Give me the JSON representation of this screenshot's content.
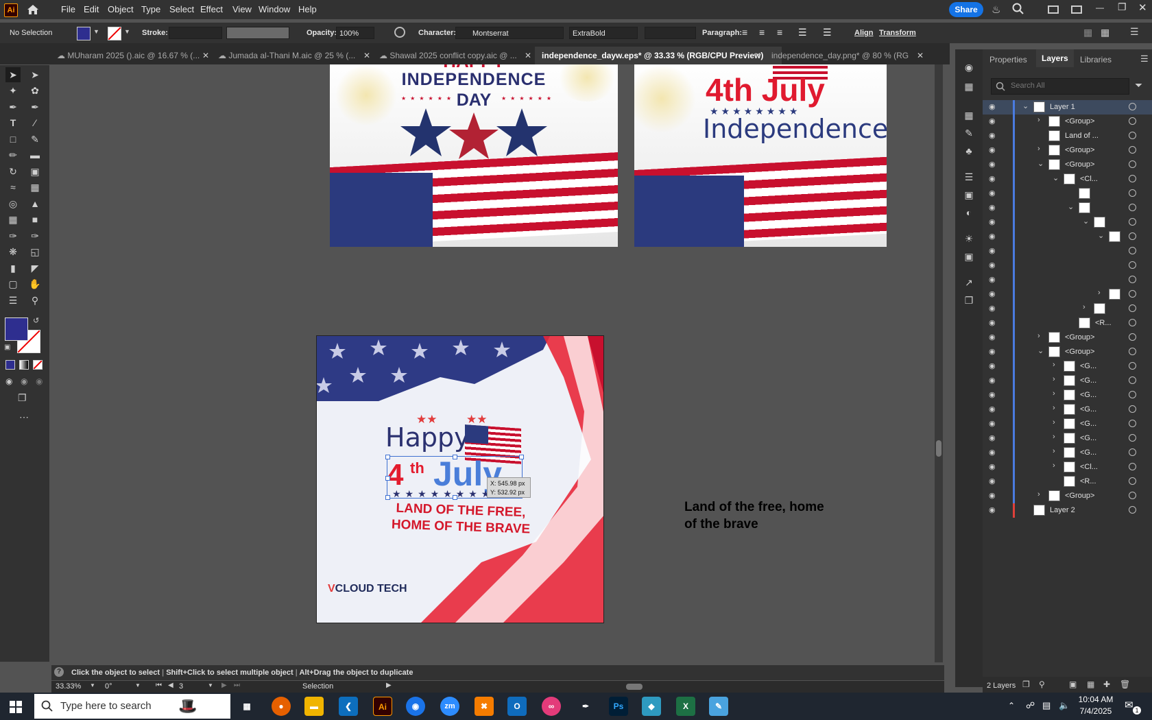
{
  "menu": {
    "app_logo": "Ai",
    "items": [
      "File",
      "Edit",
      "Object",
      "Type",
      "Select",
      "Effect",
      "View",
      "Window",
      "Help"
    ],
    "share_label": "Share"
  },
  "control_bar": {
    "selection": "No Selection",
    "stroke_label": "Stroke:",
    "opacity_label": "Opacity:",
    "opacity_value": "100%",
    "character_label": "Character:",
    "font_family": "Montserrat",
    "font_style": "ExtraBold",
    "paragraph_label": "Paragraph:",
    "align_label": "Align",
    "transform_label": "Transform",
    "fill_color": "#2e2e8f"
  },
  "tabs": [
    {
      "label": "MUharam 2025 ().aic @ 16.67 % (...",
      "active": false
    },
    {
      "label": "Jumada al-Thani M.aic @ 25 % (...",
      "active": false
    },
    {
      "label": "Shawal 2025 conflict copy.aic @ ...",
      "active": false
    },
    {
      "label": "independence_dayw.eps* @ 33.33 % (RGB/CPU Preview)",
      "active": true
    },
    {
      "label": "independence_day.png* @ 80 % (RG...",
      "active": false
    }
  ],
  "artboards": {
    "top_left": {
      "title_top": "HAPPY",
      "title_main": "INDEPENDENCE",
      "title_sub": "DAY"
    },
    "top_right": {
      "line1": "4th July",
      "line2": "Independence"
    },
    "main": {
      "happy": "Happy",
      "four": "4",
      "th": "th",
      "july": "July",
      "slogan1": "LAND OF THE FREE,",
      "slogan2": "HOME OF THE BRAVE",
      "brand_v": "V",
      "brand_rest": "CLOUD TECH",
      "coord_x": "X: 545.98 px",
      "coord_y": "Y: 532.92 px"
    },
    "floating_text": {
      "line1": "Land of the free, home",
      "line2": "of the brave"
    }
  },
  "panel": {
    "tabs": [
      "Properties",
      "Layers",
      "Libraries"
    ],
    "active_tab": "Layers",
    "search_placeholder": "Search All",
    "layers": [
      {
        "name": "Layer 1",
        "indent": 0,
        "chevron": "down",
        "thumb": true
      },
      {
        "name": "<Group>",
        "indent": 1,
        "chevron": "right",
        "thumb": true
      },
      {
        "name": "Land of ...",
        "indent": 1,
        "chevron": "",
        "thumb": true
      },
      {
        "name": "<Group>",
        "indent": 1,
        "chevron": "right",
        "thumb": true
      },
      {
        "name": "<Group>",
        "indent": 1,
        "chevron": "down",
        "thumb": true
      },
      {
        "name": "<Cl...",
        "indent": 2,
        "chevron": "down",
        "thumb": true
      },
      {
        "name": "",
        "indent": 3,
        "chevron": "",
        "thumb": true
      },
      {
        "name": "",
        "indent": 3,
        "chevron": "down",
        "thumb": true
      },
      {
        "name": "",
        "indent": 4,
        "chevron": "down",
        "thumb": true
      },
      {
        "name": "",
        "indent": 5,
        "chevron": "down",
        "thumb": true
      },
      {
        "name": "",
        "indent": 6,
        "chevron": "",
        "thumb": false
      },
      {
        "name": "",
        "indent": 6,
        "chevron": "",
        "thumb": false
      },
      {
        "name": "",
        "indent": 6,
        "chevron": "",
        "thumb": false
      },
      {
        "name": "",
        "indent": 5,
        "chevron": "right",
        "thumb": true
      },
      {
        "name": "",
        "indent": 4,
        "chevron": "right",
        "thumb": true
      },
      {
        "name": "<R...",
        "indent": 3,
        "chevron": "",
        "thumb": true
      },
      {
        "name": "<Group>",
        "indent": 1,
        "chevron": "right",
        "thumb": true
      },
      {
        "name": "<Group>",
        "indent": 1,
        "chevron": "down",
        "thumb": true
      },
      {
        "name": "<G...",
        "indent": 2,
        "chevron": "right",
        "thumb": true
      },
      {
        "name": "<G...",
        "indent": 2,
        "chevron": "right",
        "thumb": true
      },
      {
        "name": "<G...",
        "indent": 2,
        "chevron": "right",
        "thumb": true
      },
      {
        "name": "<G...",
        "indent": 2,
        "chevron": "right",
        "thumb": true
      },
      {
        "name": "<G...",
        "indent": 2,
        "chevron": "right",
        "thumb": true
      },
      {
        "name": "<G...",
        "indent": 2,
        "chevron": "right",
        "thumb": true
      },
      {
        "name": "<G...",
        "indent": 2,
        "chevron": "right",
        "thumb": true
      },
      {
        "name": "<Cl...",
        "indent": 2,
        "chevron": "right",
        "thumb": true
      },
      {
        "name": "<R...",
        "indent": 2,
        "chevron": "",
        "thumb": true
      },
      {
        "name": "<Group>",
        "indent": 1,
        "chevron": "right",
        "thumb": true
      },
      {
        "name": "Layer 2",
        "indent": 0,
        "chevron": "",
        "thumb": true
      }
    ],
    "layer_count": "2 Layers"
  },
  "status": {
    "hint1": "Click the object to select",
    "hint2": "Shift+Click to select multiple object",
    "hint3": "Alt+Drag the object to duplicate",
    "zoom": "33.33%",
    "rotation": "0°",
    "artboard_num": "3",
    "tool": "Selection"
  },
  "taskbar": {
    "search_placeholder": "Type here to search",
    "time": "10:04 AM",
    "date": "7/4/2025",
    "notification_count": "1"
  }
}
